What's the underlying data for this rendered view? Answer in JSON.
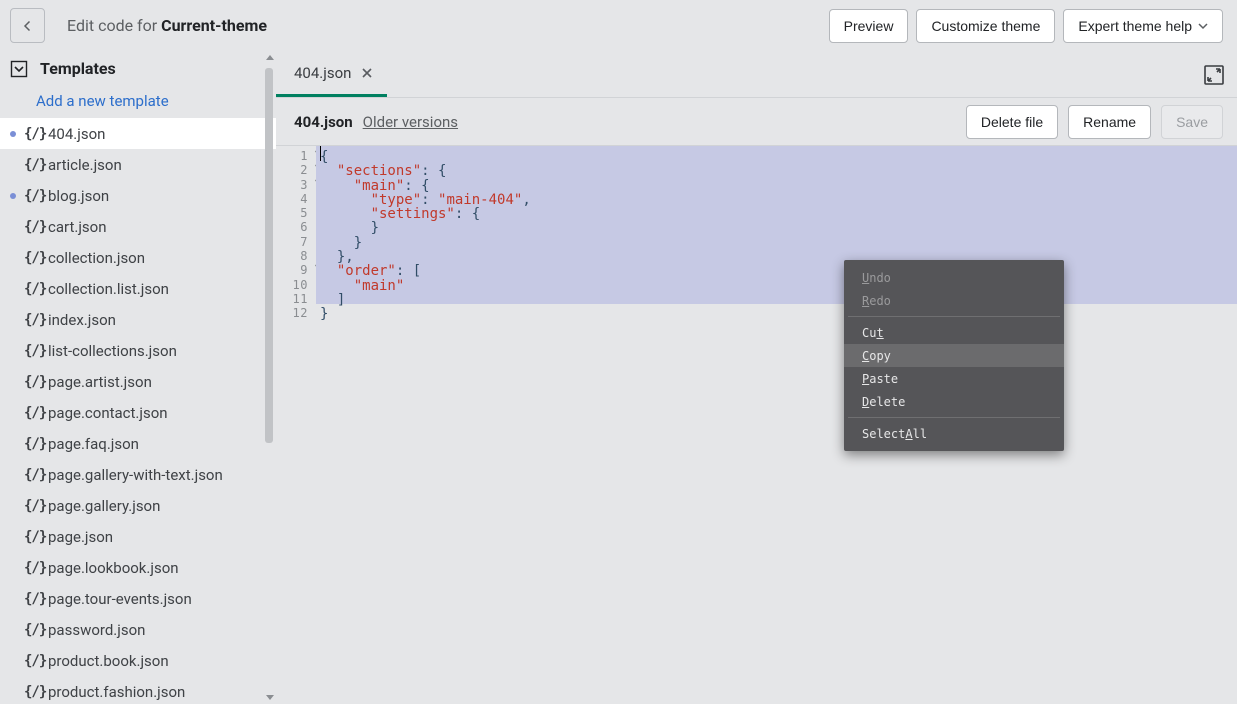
{
  "topbar": {
    "title_prefix": "Edit code for ",
    "title_theme": "Current-theme",
    "preview": "Preview",
    "customize": "Customize theme",
    "expert_help": "Expert theme help"
  },
  "sidebar": {
    "header": "Templates",
    "add_template": "Add a new template",
    "files": [
      {
        "name": "404.json",
        "sel": true,
        "mod": true
      },
      {
        "name": "article.json",
        "sel": false,
        "mod": false
      },
      {
        "name": "blog.json",
        "sel": false,
        "mod": true
      },
      {
        "name": "cart.json",
        "sel": false,
        "mod": false
      },
      {
        "name": "collection.json",
        "sel": false,
        "mod": false
      },
      {
        "name": "collection.list.json",
        "sel": false,
        "mod": false
      },
      {
        "name": "index.json",
        "sel": false,
        "mod": false
      },
      {
        "name": "list-collections.json",
        "sel": false,
        "mod": false
      },
      {
        "name": "page.artist.json",
        "sel": false,
        "mod": false
      },
      {
        "name": "page.contact.json",
        "sel": false,
        "mod": false
      },
      {
        "name": "page.faq.json",
        "sel": false,
        "mod": false
      },
      {
        "name": "page.gallery-with-text.json",
        "sel": false,
        "mod": false
      },
      {
        "name": "page.gallery.json",
        "sel": false,
        "mod": false
      },
      {
        "name": "page.json",
        "sel": false,
        "mod": false
      },
      {
        "name": "page.lookbook.json",
        "sel": false,
        "mod": false
      },
      {
        "name": "page.tour-events.json",
        "sel": false,
        "mod": false
      },
      {
        "name": "password.json",
        "sel": false,
        "mod": false
      },
      {
        "name": "product.book.json",
        "sel": false,
        "mod": false
      },
      {
        "name": "product.fashion.json",
        "sel": false,
        "mod": false
      }
    ]
  },
  "tabs": {
    "items": [
      {
        "label": "404.json",
        "active": true
      }
    ]
  },
  "filebar": {
    "filename": "404.json",
    "older_versions": "Older versions",
    "delete": "Delete file",
    "rename": "Rename",
    "save": "Save"
  },
  "editor": {
    "line_count": 12,
    "fold_lines": [
      1,
      2,
      3,
      9
    ],
    "code_lines": [
      [
        {
          "c": "brace",
          "t": "{"
        }
      ],
      [
        {
          "c": "plain",
          "t": "  "
        },
        {
          "c": "key",
          "t": "\"sections\""
        },
        {
          "c": "colon",
          "t": ": "
        },
        {
          "c": "brace",
          "t": "{"
        }
      ],
      [
        {
          "c": "plain",
          "t": "    "
        },
        {
          "c": "key",
          "t": "\"main\""
        },
        {
          "c": "colon",
          "t": ": "
        },
        {
          "c": "brace",
          "t": "{"
        }
      ],
      [
        {
          "c": "plain",
          "t": "      "
        },
        {
          "c": "key",
          "t": "\"type\""
        },
        {
          "c": "colon",
          "t": ": "
        },
        {
          "c": "val",
          "t": "\"main-404\""
        },
        {
          "c": "brace",
          "t": ","
        }
      ],
      [
        {
          "c": "plain",
          "t": "      "
        },
        {
          "c": "key",
          "t": "\"settings\""
        },
        {
          "c": "colon",
          "t": ": "
        },
        {
          "c": "brace",
          "t": "{"
        }
      ],
      [
        {
          "c": "plain",
          "t": "      "
        },
        {
          "c": "brace",
          "t": "}"
        }
      ],
      [
        {
          "c": "plain",
          "t": "    "
        },
        {
          "c": "brace",
          "t": "}"
        }
      ],
      [
        {
          "c": "plain",
          "t": "  "
        },
        {
          "c": "brace",
          "t": "},"
        }
      ],
      [
        {
          "c": "plain",
          "t": "  "
        },
        {
          "c": "key",
          "t": "\"order\""
        },
        {
          "c": "colon",
          "t": ": "
        },
        {
          "c": "brace",
          "t": "["
        }
      ],
      [
        {
          "c": "plain",
          "t": "    "
        },
        {
          "c": "val",
          "t": "\"main\""
        }
      ],
      [
        {
          "c": "plain",
          "t": "  "
        },
        {
          "c": "brace",
          "t": "]"
        }
      ],
      [
        {
          "c": "brace",
          "t": "}"
        }
      ]
    ]
  },
  "context_menu": {
    "items": [
      {
        "label": "Undo",
        "ak": 0,
        "disabled": true
      },
      {
        "label": "Redo",
        "ak": 0,
        "disabled": true
      },
      {
        "sep": true
      },
      {
        "label": "Cut",
        "ak": 2,
        "disabled": false
      },
      {
        "label": "Copy",
        "ak": 0,
        "disabled": false,
        "hover": true
      },
      {
        "label": "Paste",
        "ak": 0,
        "disabled": false
      },
      {
        "label": "Delete",
        "ak": 0,
        "disabled": false
      },
      {
        "sep": true
      },
      {
        "label": "Select All",
        "ak": 7,
        "disabled": false
      }
    ]
  }
}
